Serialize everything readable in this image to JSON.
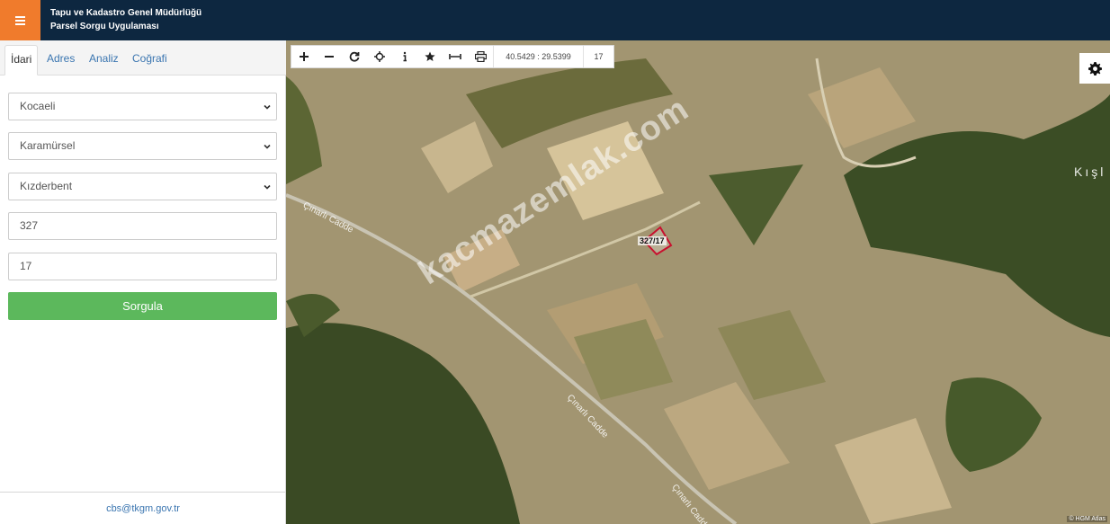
{
  "header": {
    "menu_icon": "hamburger-icon",
    "title_line1": "Tapu ve Kadastro Genel Müdürlüğü",
    "title_line2": "Parsel Sorgu Uygulaması",
    "colors": {
      "bar": "#0d2740",
      "menu": "#f07b2c"
    }
  },
  "sidebar": {
    "tabs": [
      {
        "label": "İdari",
        "active": true
      },
      {
        "label": "Adres",
        "active": false
      },
      {
        "label": "Analiz",
        "active": false
      },
      {
        "label": "Coğrafi",
        "active": false
      }
    ],
    "form": {
      "il": "Kocaeli",
      "ilce": "Karamürsel",
      "mahalle": "Kızderbent",
      "ada": "327",
      "parsel": "17",
      "submit_label": "Sorgula"
    },
    "footer_email": "cbs@tkgm.gov.tr",
    "submit_color": "#5cb85c"
  },
  "map": {
    "toolbar": {
      "icons": [
        "zoom-in-icon",
        "zoom-out-icon",
        "refresh-icon",
        "locate-icon",
        "info-icon",
        "favorite-icon",
        "measure-icon",
        "print-icon"
      ],
      "coordinates": "40.5429 : 29.5399",
      "zoom": "17"
    },
    "settings_icon": "gear-icon",
    "watermark": "kacmazemlak.com",
    "parcel_label": "327/17",
    "streets": [
      "Çınarlı Cadde",
      "Çınarlı Cadde",
      "Çınarlı Cadde"
    ],
    "place_label": "Kışl",
    "attribution": "© HGM Atlas"
  }
}
